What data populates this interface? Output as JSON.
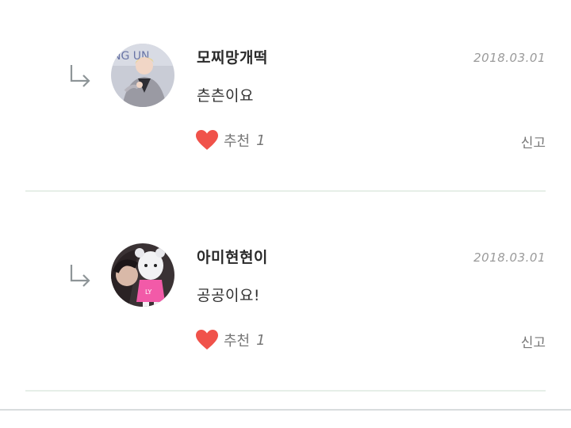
{
  "replies": [
    {
      "nickname": "모찌망개떡",
      "date": "2018.03.01",
      "content": "츤츤이요",
      "like_label": "추천",
      "like_count": "1",
      "report_label": "신고",
      "avatar_icon": "user-avatar-photo"
    },
    {
      "nickname": "아미현현이",
      "date": "2018.03.01",
      "content": "공공이요!",
      "like_label": "추천",
      "like_count": "1",
      "report_label": "신고",
      "avatar_icon": "user-avatar-photo"
    }
  ],
  "icons": {
    "reply": "reply-arrow-icon",
    "like": "heart-icon"
  },
  "colors": {
    "heart": "#f0524a",
    "divider": "#e6efe8",
    "text_muted": "#777777"
  }
}
